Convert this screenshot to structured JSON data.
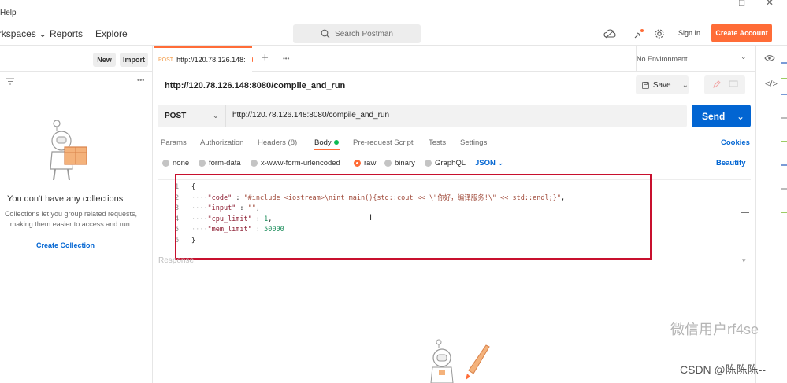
{
  "menubar": {
    "help": "Help",
    "win_controls": [
      "–",
      "□",
      "✕"
    ]
  },
  "header": {
    "workspaces": "Workspaces",
    "reports": "Reports",
    "explore": "Explore",
    "search_placeholder": "Search Postman",
    "sign_in": "Sign In",
    "create_account": "Create Account"
  },
  "sidebar": {
    "new_label": "New",
    "import_label": "Import",
    "empty_title": "You don't have any collections",
    "empty_desc_1": "Collections let you group related requests,",
    "empty_desc_2": "making them easier to access and run.",
    "create_collection": "Create Collection"
  },
  "tabs": {
    "active_method": "POST",
    "active_url": "http://120.78.126.148:",
    "add": "+",
    "more": "•••",
    "environment": "No Environment"
  },
  "request": {
    "title": "http://120.78.126.148:8080/compile_and_run",
    "save": "Save",
    "method": "POST",
    "url": "http://120.78.126.148:8080/compile_and_run",
    "send": "Send"
  },
  "request_tabs": {
    "params": "Params",
    "authorization": "Authorization",
    "headers": "Headers (8)",
    "body": "Body",
    "prerequest": "Pre-request Script",
    "tests": "Tests",
    "settings": "Settings",
    "cookies": "Cookies"
  },
  "body_types": {
    "none": "none",
    "form_data": "form-data",
    "urlencoded": "x-www-form-urlencoded",
    "raw": "raw",
    "binary": "binary",
    "graphql": "GraphQL",
    "json": "JSON",
    "beautify": "Beautify"
  },
  "code": {
    "line_numbers": [
      "1",
      "2",
      "3",
      "4",
      "5",
      "6"
    ],
    "lines": {
      "l1": "{",
      "l2_key": "\"code\"",
      "l2_val": "\"#include <iostream>\\nint main(){std::cout << \\\"你好，编译服务!\\\" << std::endl;}\"",
      "l3_key": "\"input\"",
      "l3_val": "\"\"",
      "l4_key": "\"cpu_limit\"",
      "l4_val": "1",
      "l5_key": "\"mem_limit\"",
      "l5_val": "50000",
      "l6": "}"
    }
  },
  "response": {
    "label": "Response"
  },
  "watermarks": {
    "wm1": "微信用户rf4se",
    "wm2": "CSDN @陈陈陈--"
  },
  "colors": {
    "accent": "#ff6c37",
    "primary": "#0265d2",
    "highlight": "#c8102e"
  }
}
